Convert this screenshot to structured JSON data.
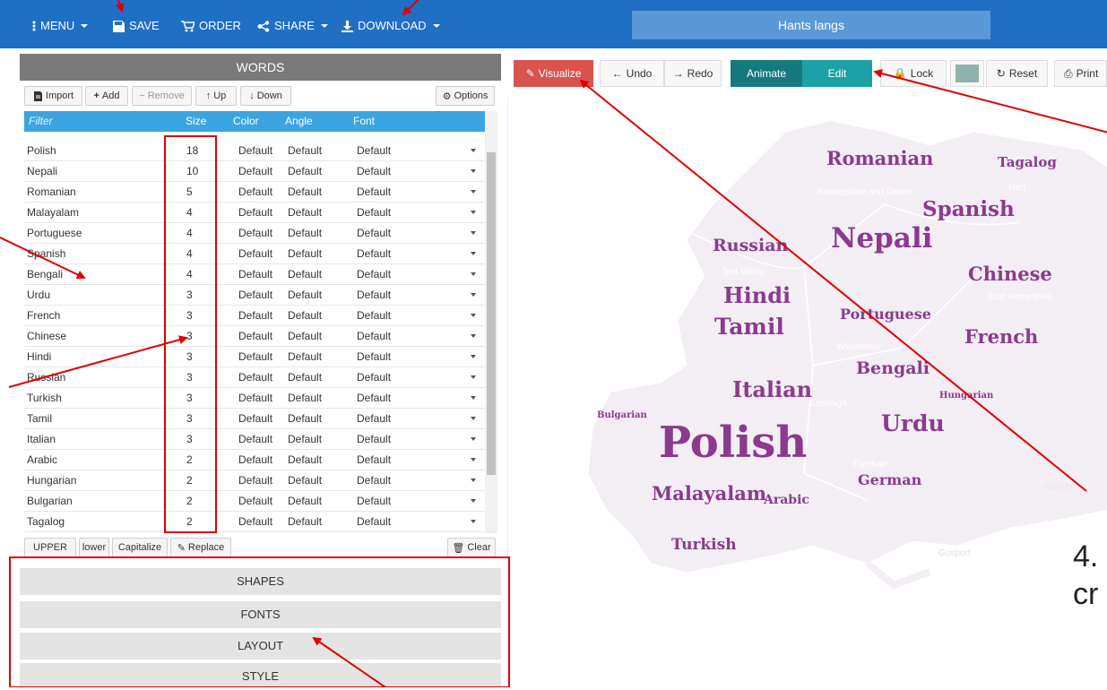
{
  "toolbar": {
    "menu": "MENU",
    "save": "SAVE",
    "order": "ORDER",
    "share": "SHARE",
    "download": "DOWNLOAD",
    "title": "Hants langs"
  },
  "left": {
    "header": "WORDS",
    "buttons": {
      "import": "Import",
      "add": "Add",
      "remove": "Remove",
      "up": "Up",
      "down": "Down",
      "options": "Options"
    },
    "columns": {
      "filter_placeholder": "Filter",
      "size": "Size",
      "color": "Color",
      "angle": "Angle",
      "font": "Font"
    },
    "rows": [
      {
        "word": "Polish",
        "size": "18",
        "color": "Default",
        "angle": "Default",
        "font": "Default"
      },
      {
        "word": "Nepali",
        "size": "10",
        "color": "Default",
        "angle": "Default",
        "font": "Default"
      },
      {
        "word": "Romanian",
        "size": "5",
        "color": "Default",
        "angle": "Default",
        "font": "Default"
      },
      {
        "word": "Malayalam",
        "size": "4",
        "color": "Default",
        "angle": "Default",
        "font": "Default"
      },
      {
        "word": "Portuguese",
        "size": "4",
        "color": "Default",
        "angle": "Default",
        "font": "Default"
      },
      {
        "word": "Spanish",
        "size": "4",
        "color": "Default",
        "angle": "Default",
        "font": "Default"
      },
      {
        "word": "Bengali",
        "size": "4",
        "color": "Default",
        "angle": "Default",
        "font": "Default"
      },
      {
        "word": "Urdu",
        "size": "3",
        "color": "Default",
        "angle": "Default",
        "font": "Default"
      },
      {
        "word": "French",
        "size": "3",
        "color": "Default",
        "angle": "Default",
        "font": "Default"
      },
      {
        "word": "Chinese",
        "size": "3",
        "color": "Default",
        "angle": "Default",
        "font": "Default"
      },
      {
        "word": "Hindi",
        "size": "3",
        "color": "Default",
        "angle": "Default",
        "font": "Default"
      },
      {
        "word": "Russian",
        "size": "3",
        "color": "Default",
        "angle": "Default",
        "font": "Default"
      },
      {
        "word": "Turkish",
        "size": "3",
        "color": "Default",
        "angle": "Default",
        "font": "Default"
      },
      {
        "word": "Tamil",
        "size": "3",
        "color": "Default",
        "angle": "Default",
        "font": "Default"
      },
      {
        "word": "Italian",
        "size": "3",
        "color": "Default",
        "angle": "Default",
        "font": "Default"
      },
      {
        "word": "Arabic",
        "size": "2",
        "color": "Default",
        "angle": "Default",
        "font": "Default"
      },
      {
        "word": "Hungarian",
        "size": "2",
        "color": "Default",
        "angle": "Default",
        "font": "Default"
      },
      {
        "word": "Bulgarian",
        "size": "2",
        "color": "Default",
        "angle": "Default",
        "font": "Default"
      },
      {
        "word": "Tagalog",
        "size": "2",
        "color": "Default",
        "angle": "Default",
        "font": "Default"
      }
    ],
    "case_buttons": {
      "upper": "UPPER",
      "lower": "lower",
      "capitalize": "Capitalize",
      "replace": "Replace",
      "clear": "Clear"
    },
    "sections": [
      "SHAPES",
      "FONTS",
      "LAYOUT",
      "STYLE"
    ]
  },
  "right": {
    "visualize": "Visualize",
    "undo": "Undo",
    "redo": "Redo",
    "animate": "Animate",
    "edit": "Edit",
    "lock": "Lock",
    "reset": "Reset",
    "print": "Print",
    "swatch_color": "#8fb3ad"
  },
  "cloud": {
    "words": {
      "polish": "Polish",
      "nepali": "Nepali",
      "romanian": "Romanian",
      "spanish": "Spanish",
      "russian": "Russian",
      "hindi": "Hindi",
      "tamil": "Tamil",
      "portuguese": "Portuguese",
      "chinese": "Chinese",
      "french": "French",
      "bengali": "Bengali",
      "italian": "Italian",
      "hungarian": "Hungarian",
      "urdu": "Urdu",
      "bulgarian": "Bulgarian",
      "german": "German",
      "malayalam": "Malayalam",
      "arabic": "Arabic",
      "turkish": "Turkish",
      "tagalog": "Tagalog"
    },
    "places": {
      "basingstoke": "Basingstoke and Deane",
      "hart": "Hart",
      "test_valley": "Test Valley",
      "east_hampshire": "East Hampshire",
      "winchester": "Winchester",
      "eastleigh": "Eastleigh",
      "gosport": "Gosport",
      "fareham": "Fareham",
      "havant": "Havant"
    },
    "colors": {
      "word": "#8b3a8e",
      "map": "#f3edf4"
    }
  },
  "annotation": {
    "step_line1": "4.",
    "step_line2": "cr"
  }
}
